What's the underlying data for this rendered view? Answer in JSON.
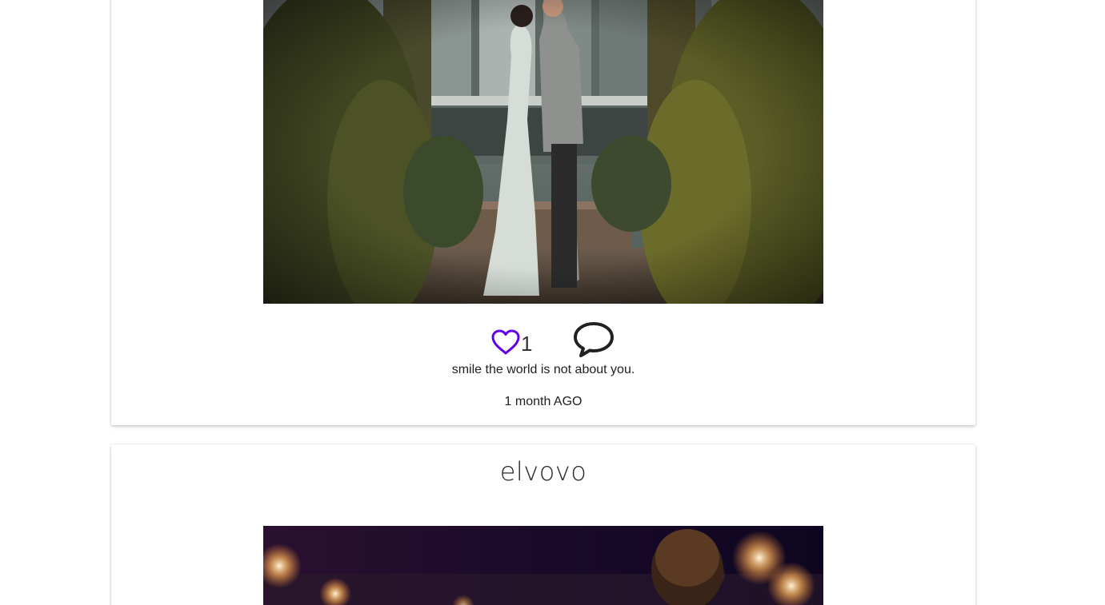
{
  "posts": [
    {
      "image": {
        "subject": "couple-embracing-in-garden-photo"
      },
      "likes": {
        "count": "1",
        "icon": "heart-outline-icon",
        "color": "#6200ea"
      },
      "comment_icon": "speech-bubble-icon",
      "caption": "smile the world is not about you.",
      "time_ago": "1 month AGO"
    },
    {
      "username": "elvovo",
      "image": {
        "subject": "night-sparklers-photo"
      }
    }
  ],
  "colors": {
    "accent": "#6200ea",
    "text": "#212121",
    "card_background": "#ffffff",
    "page_background": "#ffffff"
  }
}
